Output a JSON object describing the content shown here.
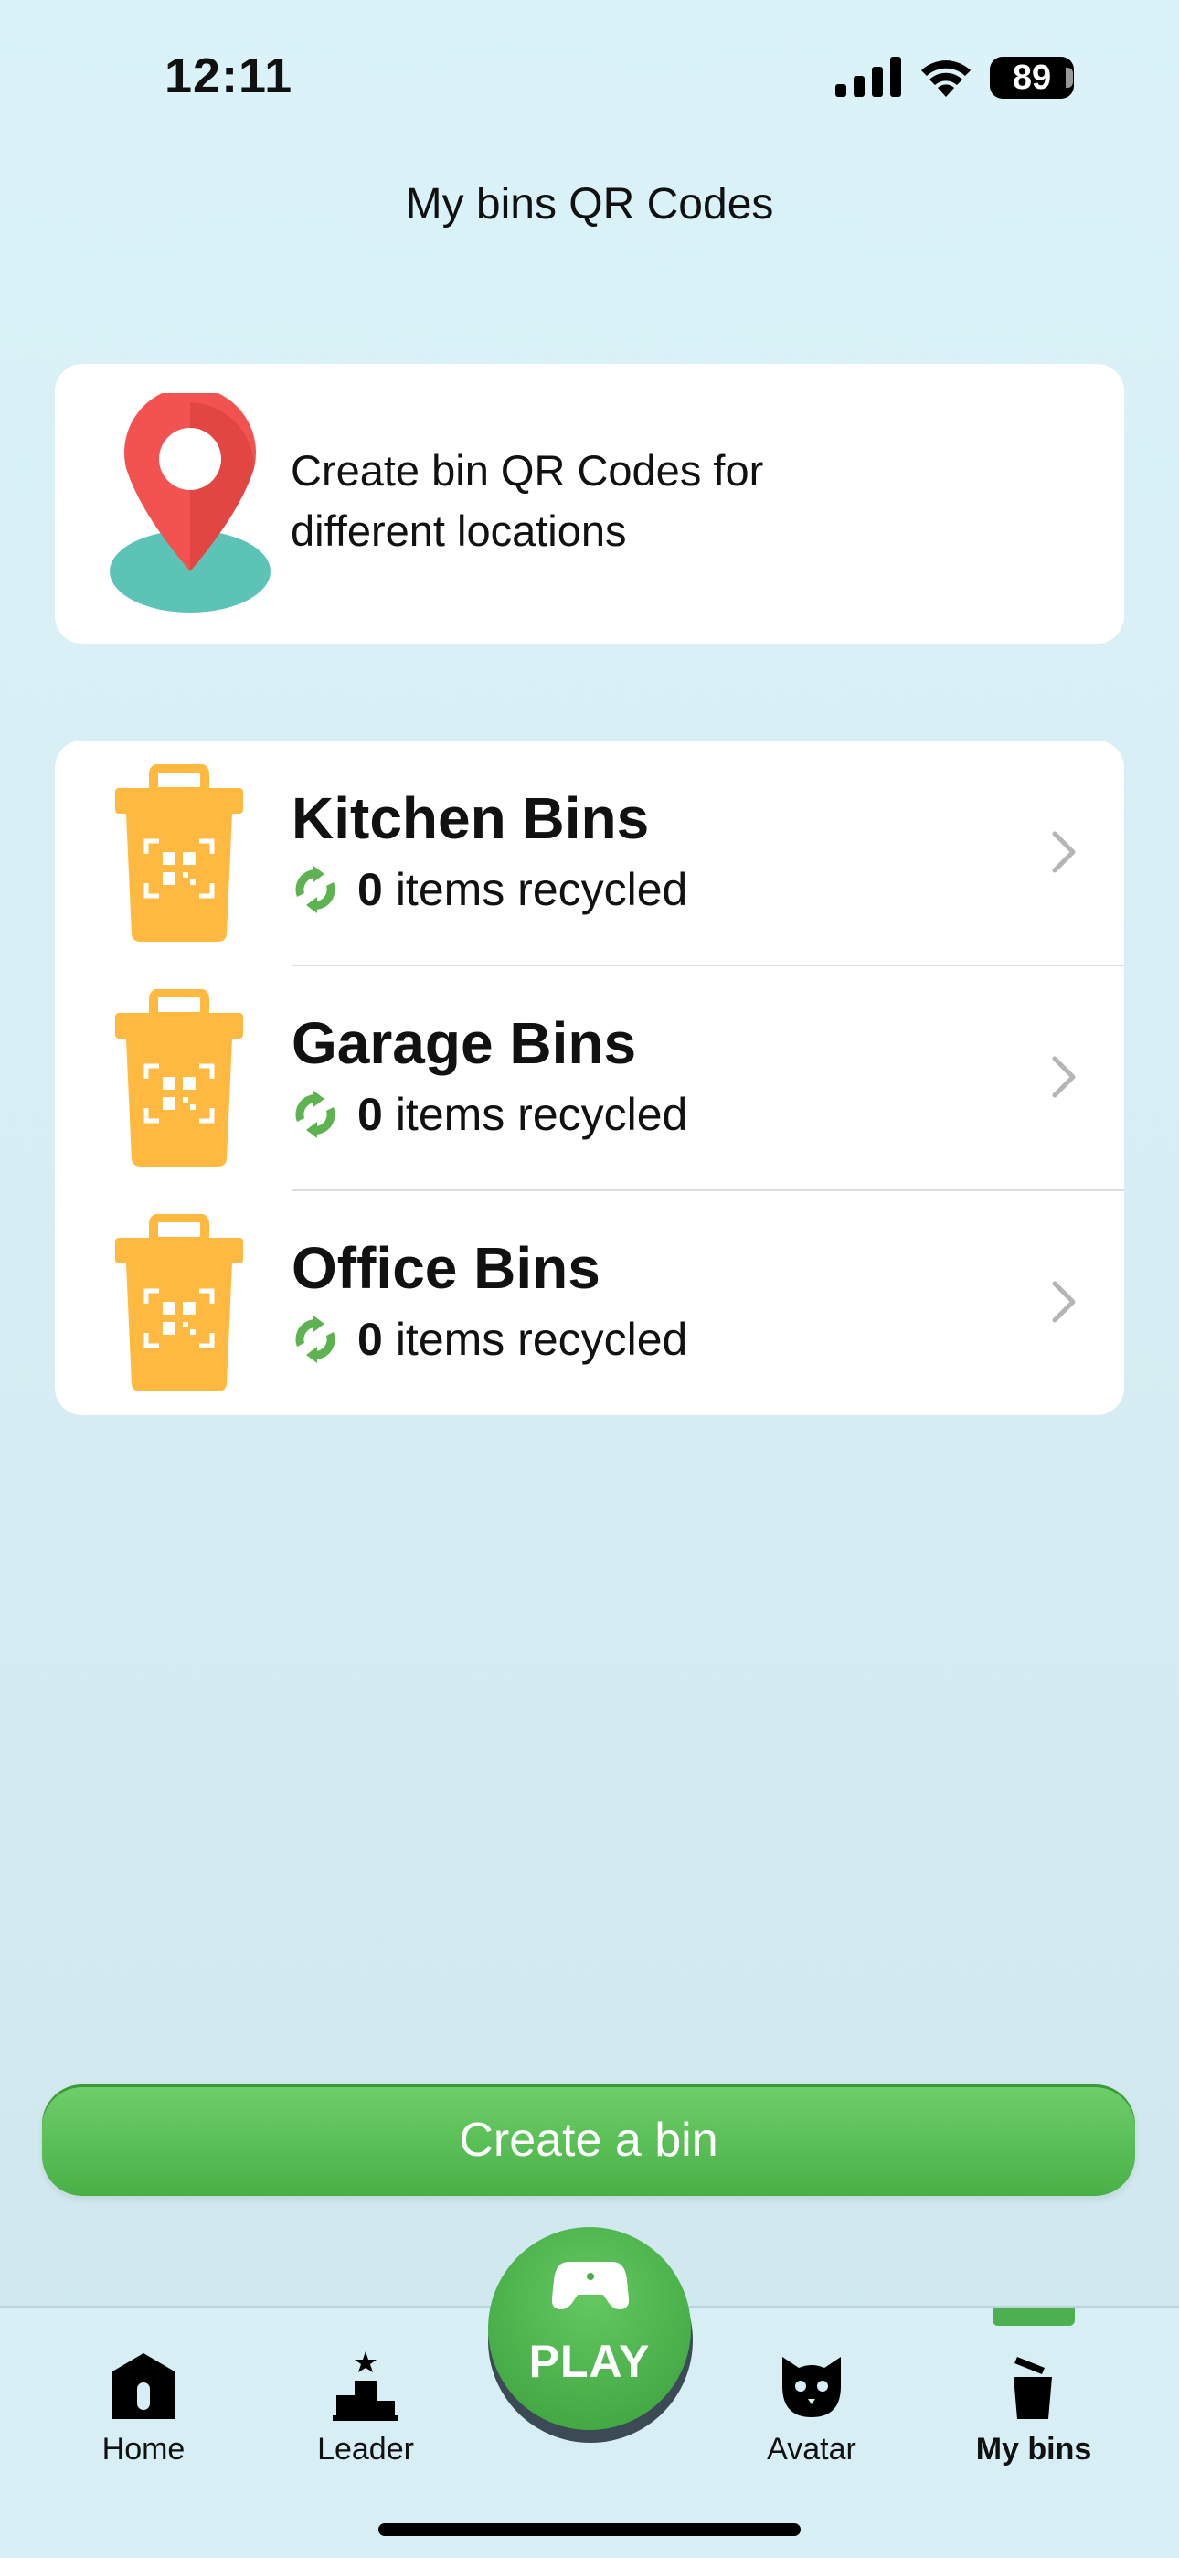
{
  "status_bar": {
    "time": "12:11",
    "battery": "89"
  },
  "header": {
    "title": "My bins QR Codes"
  },
  "info_card": {
    "text": "Create bin QR Codes for different locations"
  },
  "bins": [
    {
      "name": "Kitchen Bins",
      "count": "0",
      "suffix": "items recycled"
    },
    {
      "name": "Garage Bins",
      "count": "0",
      "suffix": "items recycled"
    },
    {
      "name": "Office Bins",
      "count": "0",
      "suffix": "items recycled"
    }
  ],
  "create_button": {
    "label": "Create a bin"
  },
  "tabbar": {
    "home": "Home",
    "leader": "Leader",
    "play": "PLAY",
    "avatar": "Avatar",
    "my_bins": "My bins",
    "active_tab": "My bins"
  },
  "colors": {
    "accent_green": "#4caf50",
    "bin_yellow": "#ffb941",
    "pin_red": "#f25350",
    "pin_base": "#5cc4b6"
  }
}
